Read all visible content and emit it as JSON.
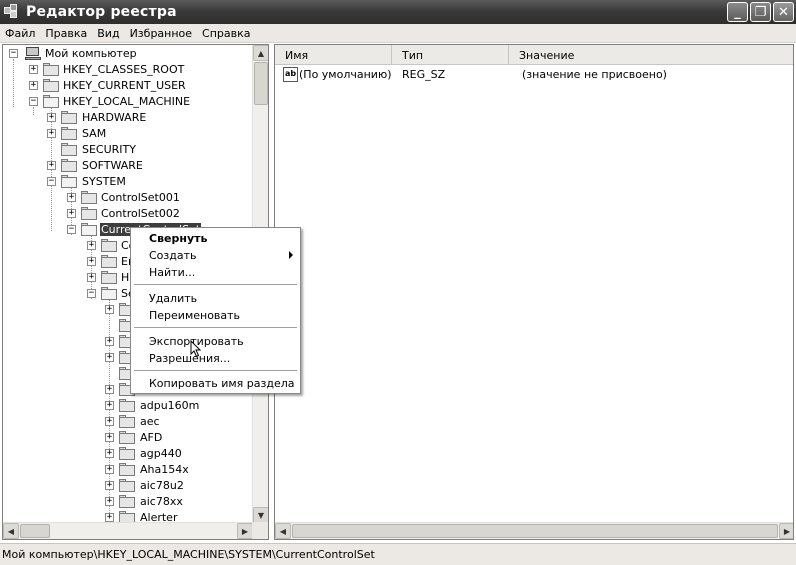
{
  "window": {
    "title": "Редактор реестра",
    "buttons": [
      "_",
      "❐",
      "✕"
    ]
  },
  "menu": [
    "Файл",
    "Правка",
    "Вид",
    "Избранное",
    "Справка"
  ],
  "tree": {
    "root": "Мой компьютер",
    "hkcr": "HKEY_CLASSES_ROOT",
    "hkcu": "HKEY_CURRENT_USER",
    "hklm": "HKEY_LOCAL_MACHINE",
    "hardware": "HARDWARE",
    "sam": "SAM",
    "security": "SECURITY",
    "software": "SOFTWARE",
    "system": "SYSTEM",
    "cs001": "ControlSet001",
    "cs002": "ControlSet002",
    "ccs": "CurrentControlSet",
    "ccs_children": [
      "Co",
      "En",
      "Ha",
      "Se"
    ],
    "services": [
      "adpu160m",
      "aec",
      "AFD",
      "agp440",
      "Aha154x",
      "aic78u2",
      "aic78xx",
      "Alerter"
    ]
  },
  "list": {
    "columns": [
      "Имя",
      "Тип",
      "Значение"
    ],
    "rows": [
      {
        "name": "(По умолчанию)",
        "type": "REG_SZ",
        "value": "(значение не присвоено)",
        "icon": "ab-string-icon"
      }
    ]
  },
  "context_menu": {
    "collapse": "Свернуть",
    "create": "Создать",
    "find": "Найти...",
    "delete": "Удалить",
    "rename": "Переименовать",
    "export": "Экспортировать",
    "permissions": "Разрешения...",
    "copy_key": "Копировать имя раздела"
  },
  "statusbar": "Мой компьютер\\HKEY_LOCAL_MACHINE\\SYSTEM\\CurrentControlSet"
}
